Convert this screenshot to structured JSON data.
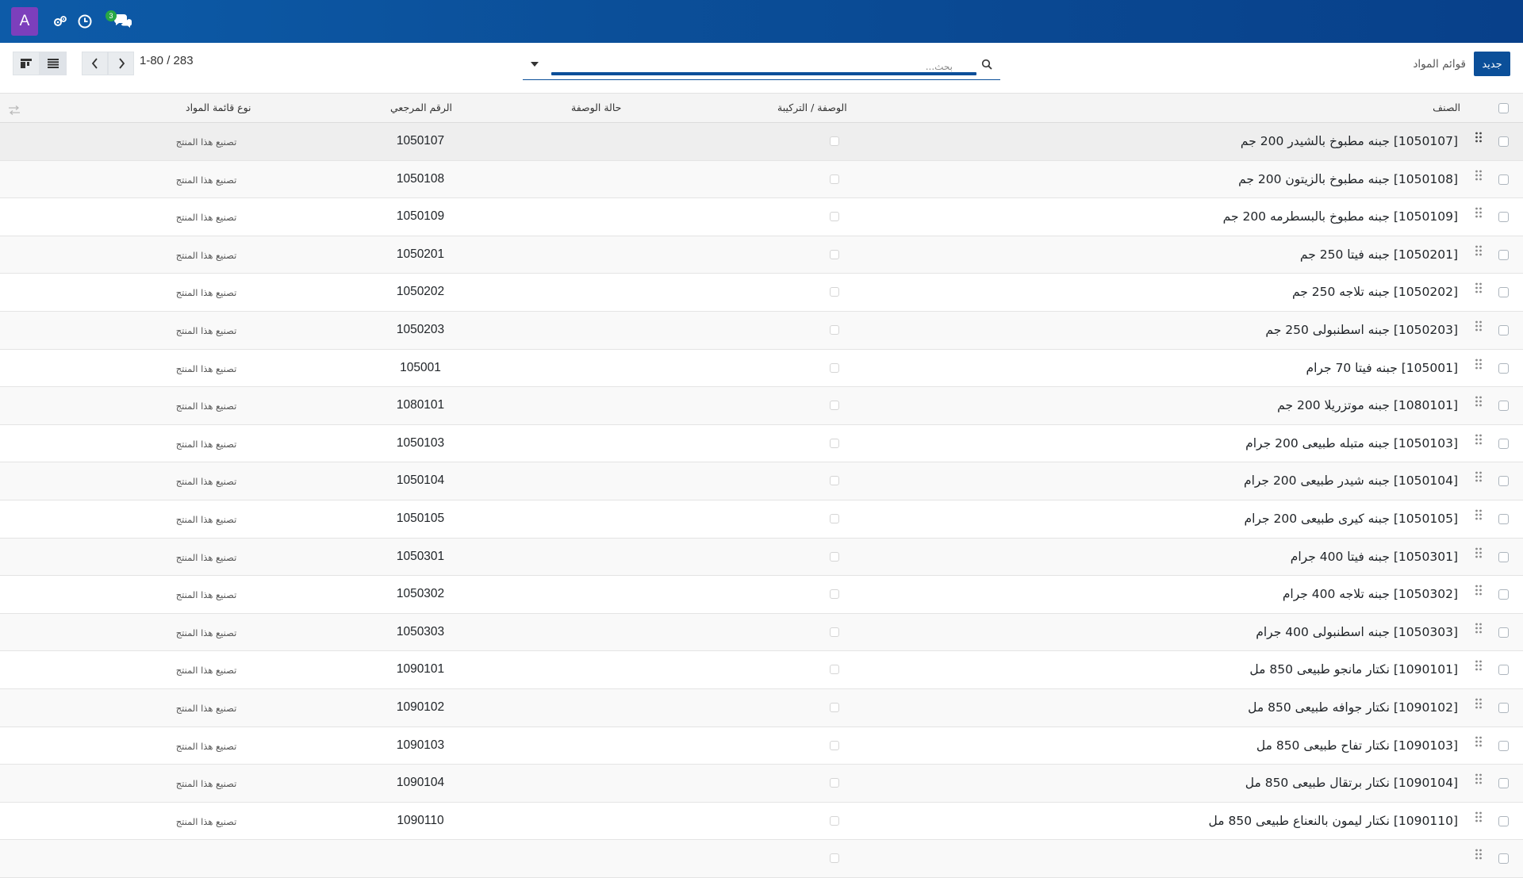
{
  "navbar": {
    "avatar_letter": "A",
    "avatar_color": "#7c3fbc",
    "navbar_color": "#0b4f99",
    "icons": [
      "debug-icon",
      "clock-icon",
      "chat-icon"
    ],
    "messages_badge": "3"
  },
  "control_panel": {
    "breadcrumb": "قوائم المواد",
    "new_button": "جديد",
    "search_placeholder": "بحث...",
    "pager_value": "1-80 / 283",
    "views": [
      "kanban-view-icon",
      "list-view-icon"
    ]
  },
  "table": {
    "columns": {
      "product": "الصنف",
      "recipe": "الوصفة / التركيبة",
      "recipe_status": "حالة الوصفة",
      "reference": "الرقم المرجعي",
      "bom_type": "نوع قائمة المواد"
    },
    "rows": [
      {
        "product": "[1050107] جبنه مطبوخ بالشيدر 200 جم",
        "reference": "1050107",
        "bom_type": "تصنيع هذا المنتج"
      },
      {
        "product": "[1050108] جبنه مطبوخ بالزيتون 200 جم",
        "reference": "1050108",
        "bom_type": "تصنيع هذا المنتج"
      },
      {
        "product": "[1050109] جبنه مطبوخ بالبسطرمه 200 جم",
        "reference": "1050109",
        "bom_type": "تصنيع هذا المنتج"
      },
      {
        "product": "[1050201] جبنه فيتا 250 جم",
        "reference": "1050201",
        "bom_type": "تصنيع هذا المنتج"
      },
      {
        "product": "[1050202] جبنه تلاجه 250 جم",
        "reference": "1050202",
        "bom_type": "تصنيع هذا المنتج"
      },
      {
        "product": "[1050203] جبنه اسطنبولى 250 جم",
        "reference": "1050203",
        "bom_type": "تصنيع هذا المنتج"
      },
      {
        "product": "[105001] جبنه فيتا 70 جرام",
        "reference": "105001",
        "bom_type": "تصنيع هذا المنتج"
      },
      {
        "product": "[1080101] جبنه موتزريلا 200 جم",
        "reference": "1080101",
        "bom_type": "تصنيع هذا المنتج"
      },
      {
        "product": "[1050103] جبنه متبله طبيعى 200 جرام",
        "reference": "1050103",
        "bom_type": "تصنيع هذا المنتج"
      },
      {
        "product": "[1050104] جبنه شيدر طبيعى 200 جرام",
        "reference": "1050104",
        "bom_type": "تصنيع هذا المنتج"
      },
      {
        "product": "[1050105] جبنه كيرى طبيعى 200 جرام",
        "reference": "1050105",
        "bom_type": "تصنيع هذا المنتج"
      },
      {
        "product": "[1050301] جبنه فيتا 400 جرام",
        "reference": "1050301",
        "bom_type": "تصنيع هذا المنتج"
      },
      {
        "product": "[1050302] جبنه تلاجه 400 جرام",
        "reference": "1050302",
        "bom_type": "تصنيع هذا المنتج"
      },
      {
        "product": "[1050303] جبنه اسطنبولى 400 جرام",
        "reference": "1050303",
        "bom_type": "تصنيع هذا المنتج"
      },
      {
        "product": "[1090101] نكتار مانجو طبيعى 850 مل",
        "reference": "1090101",
        "bom_type": "تصنيع هذا المنتج"
      },
      {
        "product": "[1090102] نكتار جوافه طبيعى 850 مل",
        "reference": "1090102",
        "bom_type": "تصنيع هذا المنتج"
      },
      {
        "product": "[1090103] نكتار تفاح طبيعى 850 مل",
        "reference": "1090103",
        "bom_type": "تصنيع هذا المنتج"
      },
      {
        "product": "[1090104] نكتار برتقال طبيعى 850 مل",
        "reference": "1090104",
        "bom_type": "تصنيع هذا المنتج"
      },
      {
        "product": "[1090110] نكتار ليمون بالنعناع طبيعى 850 مل",
        "reference": "1090110",
        "bom_type": "تصنيع هذا المنتج"
      },
      {
        "product": "",
        "reference": "",
        "bom_type": ""
      }
    ]
  }
}
